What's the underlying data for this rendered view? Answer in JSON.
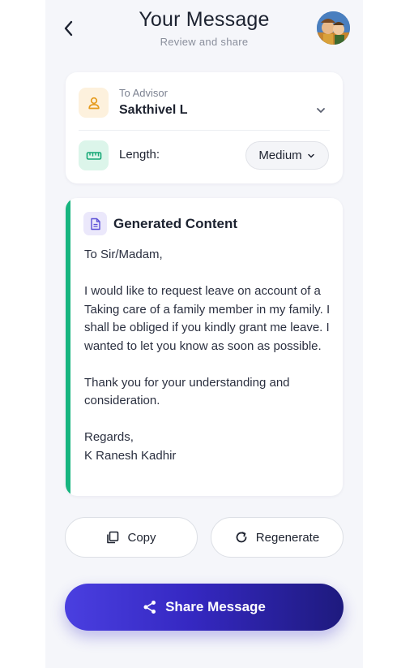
{
  "header": {
    "title": "Your Message",
    "subtitle": "Review and share"
  },
  "advisor": {
    "label": "To Advisor",
    "name": "Sakthivel L",
    "length_label": "Length:",
    "length_value": "Medium"
  },
  "content": {
    "title": "Generated Content",
    "paragraphs": [
      "To Sir/Madam,",
      "I would like to request leave on account of a Taking care of a family member in my family. I shall be obliged if you kindly grant me leave. I wanted to let you know as soon as possible.",
      "Thank you for your understanding and consideration.",
      "Regards,"
    ],
    "signature": "K Ranesh Kadhir"
  },
  "actions": {
    "copy_label": "Copy",
    "regenerate_label": "Regenerate",
    "share_label": "Share Message"
  },
  "colors": {
    "accent_green": "#17b57f",
    "share_gradient_start": "#4a3fe0",
    "share_gradient_end": "#1e1a7e"
  },
  "icons": [
    "chevron-left-icon",
    "avatar",
    "person-icon",
    "chevron-down-icon",
    "ruler-icon",
    "document-icon",
    "copy-icon",
    "refresh-icon",
    "share-icon"
  ]
}
